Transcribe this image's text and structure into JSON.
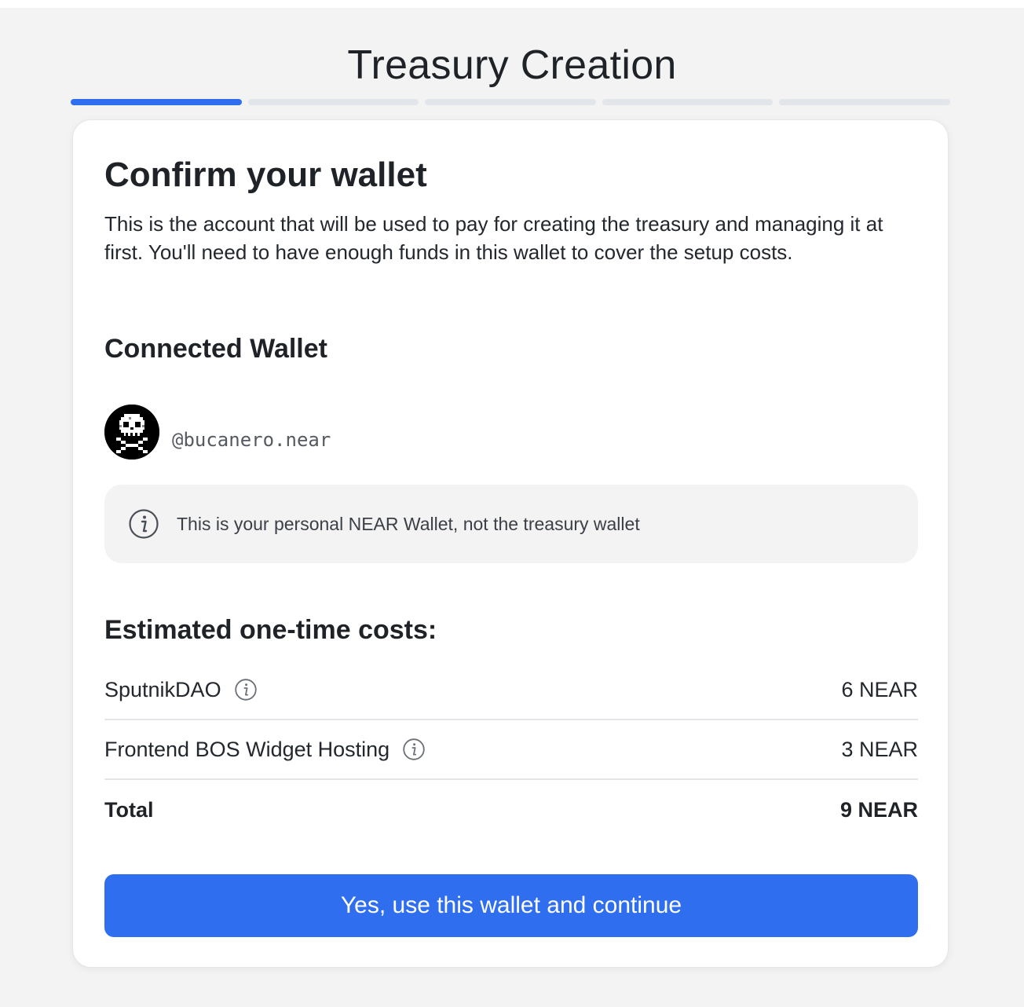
{
  "header": {
    "title": "Treasury Creation"
  },
  "progress": {
    "total_steps": 5,
    "current_step": 1,
    "active_color": "#2f6fef"
  },
  "card": {
    "title": "Confirm your wallet",
    "description": "This is the account that will be used to pay for creating the treasury and managing it at first. You'll need to have enough funds in this wallet to cover the setup costs."
  },
  "wallet": {
    "section_title": "Connected Wallet",
    "account": "@bucanero.near",
    "avatar_icon": "pixel-skull-crossbones-icon",
    "notice_icon": "info-circle-icon",
    "notice": "This is your personal NEAR Wallet, not the treasury wallet"
  },
  "costs": {
    "section_title": "Estimated one-time costs:",
    "rows": [
      {
        "label": "SputnikDAO",
        "value": "6 NEAR",
        "icon": "info-circle-icon"
      },
      {
        "label": "Frontend BOS Widget Hosting",
        "value": "3 NEAR",
        "icon": "info-circle-icon"
      }
    ],
    "total_label": "Total",
    "total_value": "9 NEAR"
  },
  "actions": {
    "continue_label": "Yes, use this wallet and continue"
  }
}
